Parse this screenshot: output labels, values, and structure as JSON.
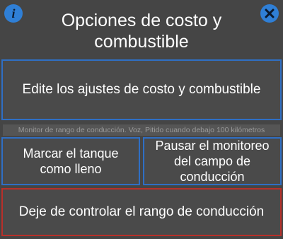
{
  "header": {
    "title": "Opciones de costo y combustible",
    "info_icon_glyph": "i",
    "close_icon": "close-icon",
    "accent_color": "#2f7fd6"
  },
  "buttons": {
    "edit_label": "Edite los ajustes de costo y combustible",
    "fill_tank_label": "Marcar el tanque como lleno",
    "pause_label": "Pausar el monitoreo del campo de conducción",
    "stop_label": "Deje de controlar el rango de conducción"
  },
  "status": {
    "text": "Monitor de rango de conducción. Voz, Pitido cuando debajo 100 kilómetros"
  }
}
